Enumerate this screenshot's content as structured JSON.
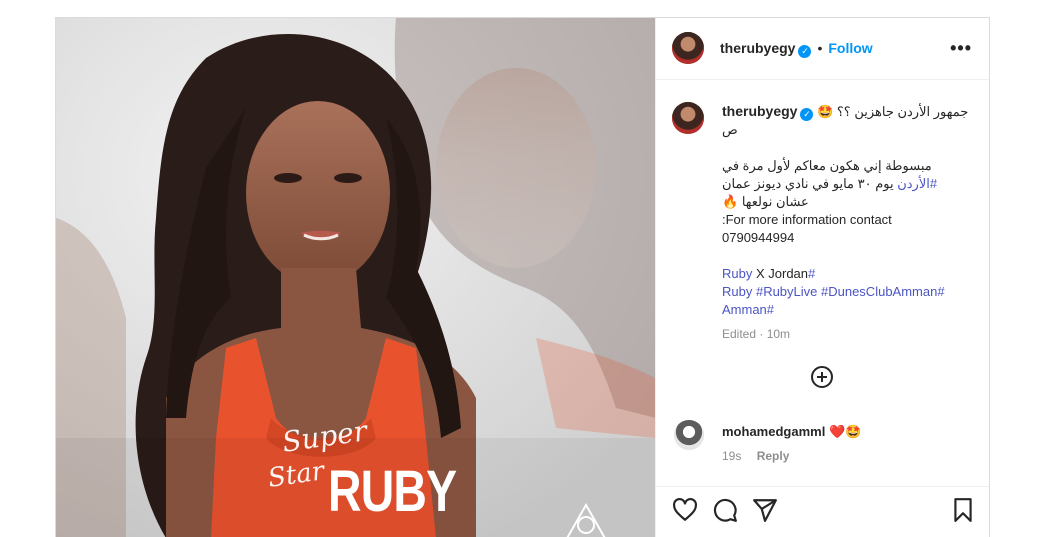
{
  "header": {
    "username": "therubyegy",
    "verified_mark": "✓",
    "separator": "•",
    "follow_label": "Follow",
    "more_label": "•••"
  },
  "caption": {
    "username": "therubyegy",
    "verified_mark": "✓",
    "line1_text": "جمهور الأردن جاهزين ؟؟",
    "line1_emoji": "🤩",
    "line2": "ص",
    "line3": "مبسوطة إني هكون معاكم لأول مرة في",
    "line4_hashtag": "#الأردن",
    "line4_text": "يوم ٣٠ مايو في نادي ديونز عمان",
    "line5_emoji": "🔥",
    "line5_text": "عشان نولعها",
    "line6": ":For more information contact",
    "line7": "0790944994",
    "tag_line1_a": "Ruby",
    "tag_line1_b": " X Jordan",
    "tag_line1_c": "#",
    "tag_line2": "Ruby #RubyLive #DunesClubAmman#",
    "tag_line3": "Amman#",
    "edited_label": "Edited",
    "edited_sep": " · ",
    "edited_time": "10m"
  },
  "comment": {
    "username": "mohamedgamml",
    "emojis": "❤️🤩",
    "time": "19s",
    "reply_label": "Reply"
  },
  "media_text": {
    "super": "Super",
    "star": "Star",
    "ruby": "RUBY"
  },
  "icons": {
    "like": "heart-icon",
    "comment": "comment-icon",
    "share": "share-icon",
    "save": "bookmark-icon",
    "load_more": "plus-circle-icon"
  },
  "colors": {
    "link_blue": "#0095f6",
    "hashtag_blue": "#4b55c4",
    "dress": "#e8532e",
    "border": "#dbdbdb"
  }
}
